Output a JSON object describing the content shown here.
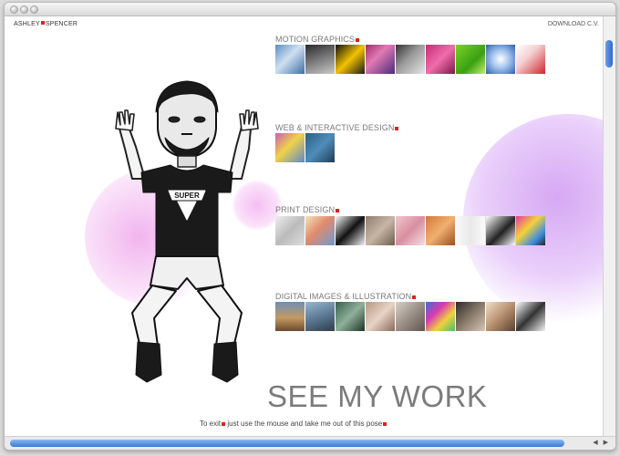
{
  "header": {
    "brand_first": "ASHLEY",
    "brand_last": "SPENCER",
    "download_cv": "DOWNLOAD C.V."
  },
  "sections": [
    {
      "title": "MOTION GRAPHICS",
      "thumbnails": [
        "motion-thumb-1",
        "motion-thumb-2",
        "motion-thumb-3",
        "motion-thumb-4",
        "motion-thumb-5",
        "motion-thumb-6",
        "motion-thumb-7",
        "motion-thumb-8"
      ]
    },
    {
      "title": "WEB & INTERACTIVE DESIGN",
      "thumbnails": [
        "web-thumb-1",
        "web-thumb-2"
      ]
    },
    {
      "title": "PRINT DESIGN",
      "thumbnails": [
        "print-thumb-1",
        "print-thumb-2",
        "print-thumb-3",
        "print-thumb-4",
        "print-thumb-5",
        "print-thumb-6",
        "print-thumb-7",
        "print-thumb-8",
        "print-thumb-9"
      ]
    },
    {
      "title": "DIGITAL IMAGES & ILLUSTRATION",
      "thumbnails": [
        "digital-thumb-1",
        "digital-thumb-2",
        "digital-thumb-3",
        "digital-thumb-4",
        "digital-thumb-5",
        "digital-thumb-6",
        "digital-thumb-7",
        "digital-thumb-8",
        "digital-thumb-9"
      ]
    }
  ],
  "figure": {
    "shirt_text": "SUPER"
  },
  "footer": {
    "headline": "SEE MY WORK",
    "exit_part1": "To exit",
    "exit_part2": " just use the mouse and take me out of this pose"
  },
  "colors": {
    "accent": "#e12020",
    "pink_blob": "#f1b5ee",
    "purple_blob": "#d6a8f3",
    "scroll_blue": "#3a78d8"
  }
}
